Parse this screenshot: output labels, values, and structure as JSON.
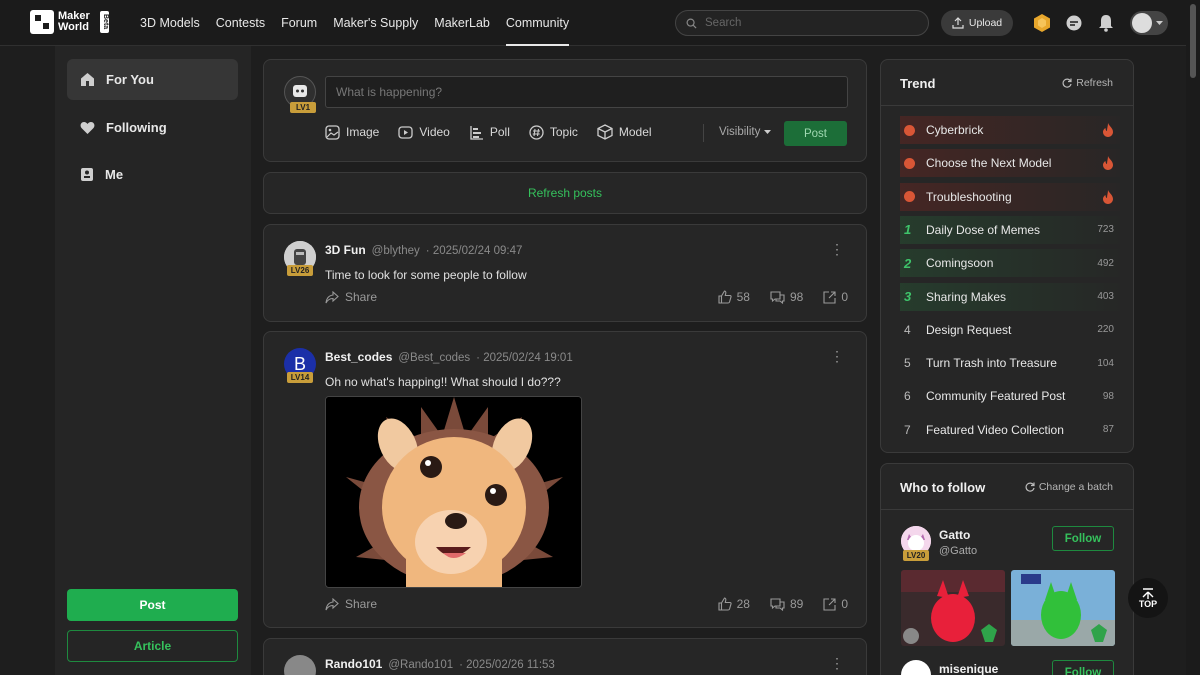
{
  "logo": {
    "line1": "Maker",
    "line2": "World",
    "beta": "Beta"
  },
  "nav": {
    "items": [
      {
        "label": "3D Models"
      },
      {
        "label": "Contests"
      },
      {
        "label": "Forum"
      },
      {
        "label": "Maker's Supply"
      },
      {
        "label": "MakerLab"
      },
      {
        "label": "Community",
        "active": true
      }
    ]
  },
  "search": {
    "placeholder": "Search"
  },
  "header": {
    "upload_label": "Upload"
  },
  "sidebar": {
    "items": [
      {
        "label": "For You",
        "icon": "home-icon",
        "active": true
      },
      {
        "label": "Following",
        "icon": "heart-icon"
      },
      {
        "label": "Me",
        "icon": "user-badge-icon"
      }
    ],
    "post_label": "Post",
    "article_label": "Article"
  },
  "composer": {
    "placeholder": "What is happening?",
    "level": "LV1",
    "tools": [
      {
        "label": "Image",
        "icon": "image-icon"
      },
      {
        "label": "Video",
        "icon": "video-icon"
      },
      {
        "label": "Poll",
        "icon": "poll-icon"
      },
      {
        "label": "Topic",
        "icon": "hashtag-icon"
      },
      {
        "label": "Model",
        "icon": "cube-icon"
      }
    ],
    "visibility_label": "Visibility",
    "post_label": "Post"
  },
  "feed": {
    "refresh_label": "Refresh posts",
    "share_label": "Share",
    "posts": [
      {
        "name": "3D Fun",
        "handle": "@blythey",
        "time": "2025/02/24 09:47",
        "level": "LV26",
        "text": "Time to look for some people to follow",
        "likes": "58",
        "comments": "98",
        "shares": "0"
      },
      {
        "name": "Best_codes",
        "handle": "@Best_codes",
        "time": "2025/02/24 19:01",
        "level": "LV14",
        "avatar_letter": "B",
        "text": "Oh no what's happing!! What should I do???",
        "likes": "28",
        "comments": "89",
        "shares": "0"
      },
      {
        "name": "Rando101",
        "handle": "@Rando101",
        "time": "2025/02/26 11:53"
      }
    ]
  },
  "trend": {
    "title": "Trend",
    "refresh_label": "Refresh",
    "items": [
      {
        "rank": "",
        "label": "Cyberbrick",
        "count": "",
        "hot": true
      },
      {
        "rank": "",
        "label": "Choose the Next Model",
        "count": "",
        "hot": true
      },
      {
        "rank": "",
        "label": "Troubleshooting",
        "count": "",
        "hot": true
      },
      {
        "rank": "1",
        "label": "Daily Dose of Memes",
        "count": "723"
      },
      {
        "rank": "2",
        "label": "Comingsoon",
        "count": "492"
      },
      {
        "rank": "3",
        "label": "Sharing Makes",
        "count": "403"
      },
      {
        "rank": "4",
        "label": "Design Request",
        "count": "220"
      },
      {
        "rank": "5",
        "label": "Turn Trash into Treasure",
        "count": "104"
      },
      {
        "rank": "6",
        "label": "Community Featured Post",
        "count": "98"
      },
      {
        "rank": "7",
        "label": "Featured Video Collection",
        "count": "87"
      }
    ]
  },
  "who_to_follow": {
    "title": "Who to follow",
    "change_label": "Change a batch",
    "users": [
      {
        "name": "Gatto",
        "handle": "@Gatto",
        "level": "LV20",
        "follow_label": "Follow"
      },
      {
        "name": "misenique",
        "follow_label": "Follow"
      }
    ]
  },
  "top_button": {
    "label": "TOP"
  },
  "colors": {
    "accent": "#1fad4f",
    "background": "#1e1e1e",
    "panel": "#262626",
    "hot": "#d95636"
  }
}
